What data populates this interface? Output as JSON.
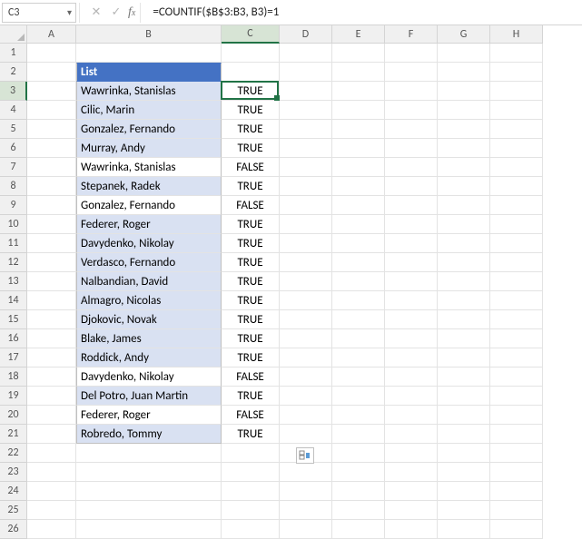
{
  "namebox": {
    "value": "C3"
  },
  "formula": "=COUNTIF($B$3:B3, B3)=1",
  "columns": [
    "A",
    "B",
    "C",
    "D",
    "E",
    "F",
    "G",
    "H"
  ],
  "active_col": "C",
  "active_row": 3,
  "header": {
    "label": "List"
  },
  "rows": [
    {
      "r": 3,
      "name": "Wawrinka, Stanislas",
      "val": "TRUE",
      "band": true
    },
    {
      "r": 4,
      "name": "Cilic, Marin",
      "val": "TRUE",
      "band": true
    },
    {
      "r": 5,
      "name": "Gonzalez, Fernando",
      "val": "TRUE",
      "band": true
    },
    {
      "r": 6,
      "name": "Murray, Andy",
      "val": "TRUE",
      "band": true
    },
    {
      "r": 7,
      "name": "Wawrinka, Stanislas",
      "val": "FALSE",
      "band": false
    },
    {
      "r": 8,
      "name": "Stepanek, Radek",
      "val": "TRUE",
      "band": true
    },
    {
      "r": 9,
      "name": "Gonzalez, Fernando",
      "val": "FALSE",
      "band": false
    },
    {
      "r": 10,
      "name": "Federer, Roger",
      "val": "TRUE",
      "band": true
    },
    {
      "r": 11,
      "name": "Davydenko, Nikolay",
      "val": "TRUE",
      "band": true
    },
    {
      "r": 12,
      "name": "Verdasco, Fernando",
      "val": "TRUE",
      "band": true
    },
    {
      "r": 13,
      "name": "Nalbandian, David",
      "val": "TRUE",
      "band": true
    },
    {
      "r": 14,
      "name": "Almagro, Nicolas",
      "val": "TRUE",
      "band": true
    },
    {
      "r": 15,
      "name": "Djokovic, Novak",
      "val": "TRUE",
      "band": true
    },
    {
      "r": 16,
      "name": "Blake, James",
      "val": "TRUE",
      "band": true
    },
    {
      "r": 17,
      "name": "Roddick, Andy",
      "val": "TRUE",
      "band": true
    },
    {
      "r": 18,
      "name": "Davydenko, Nikolay",
      "val": "FALSE",
      "band": false
    },
    {
      "r": 19,
      "name": "Del Potro, Juan Martin",
      "val": "TRUE",
      "band": true
    },
    {
      "r": 20,
      "name": "Federer, Roger",
      "val": "FALSE",
      "band": false
    },
    {
      "r": 21,
      "name": "Robredo, Tommy",
      "val": "TRUE",
      "band": true
    }
  ],
  "row_count": 26
}
